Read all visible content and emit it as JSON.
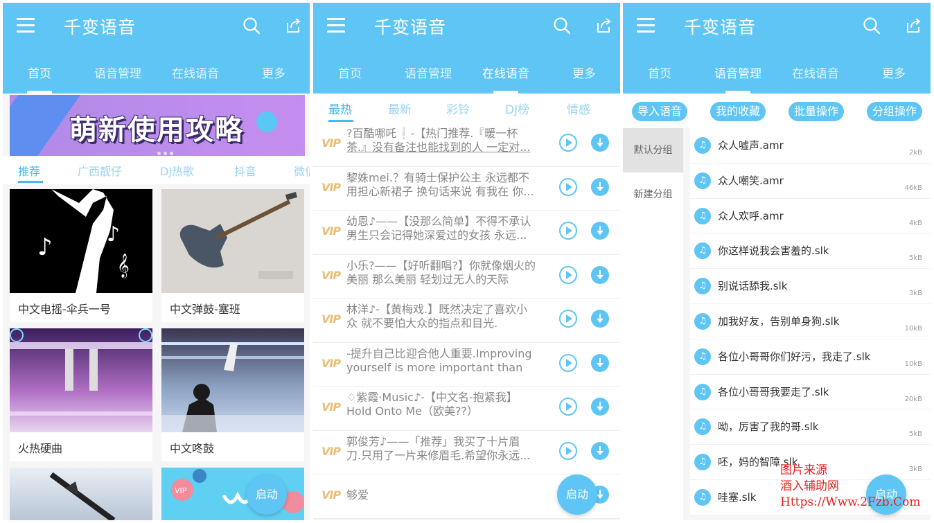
{
  "app_title": "千变语音",
  "tabs": [
    "首页",
    "语音管理",
    "在线语音",
    "更多"
  ],
  "screen1": {
    "banner_text": "萌新使用攻略",
    "categories": [
      "推荐",
      "广西靓仔",
      "DJ热歌",
      "抖音",
      "微信"
    ],
    "cards": [
      {
        "label": "中文电摇-伞兵一号"
      },
      {
        "label": "中文弹鼓-塞班"
      },
      {
        "label": "火热硬曲"
      },
      {
        "label": "中文咚鼓"
      },
      {
        "label": ""
      },
      {
        "label": ""
      }
    ],
    "card4_image_text": "VIP",
    "fab": "启动"
  },
  "screen2": {
    "subtabs": [
      "最热",
      "最新",
      "彩铃",
      "DJ榜",
      "情感"
    ],
    "vip_label": "VIP",
    "items": [
      {
        "line1": "?百酷哪吒❕-【热门推荐.『暖一杯",
        "line2": "茶.』没有备注也能找到的人 一定对..."
      },
      {
        "line1": "黎姝mei.？有骑士保护公主 永远都不",
        "line2": "用担心新裙子 换句话来说 有我在 你..."
      },
      {
        "line1": "幼恩♪——【没那么简单】不得不承认",
        "line2": "男生只会记得她深爱过的女孩 永远..."
      },
      {
        "line1": "小乐?——【好听翻唱?】你就像烟火的",
        "line2": "美丽 那么美丽 轻划过无人的天际"
      },
      {
        "line1": "林洋♪-【黄梅戏.】既然决定了喜欢小",
        "line2": "众 就不要怕大众的指点和目光."
      },
      {
        "line1": "-提升自己比迎合他人重要.Improving",
        "line2": "yourself is more important than cat..."
      },
      {
        "line1": "♢紫霞·Music♪-【中文名-抱紧我】",
        "line2": "Hold Onto Me（欧美??）"
      },
      {
        "line1": "郭俊芳♪——「推荐」我买了十片眉",
        "line2": "刀.只用了一片来修眉毛.希望你永远..."
      },
      {
        "line1": "够爱",
        "line2": ""
      }
    ],
    "fab": "启动"
  },
  "screen3": {
    "pills": [
      "导入语音",
      "我的收藏",
      "批量操作",
      "分组操作"
    ],
    "groups": [
      "默认分组",
      "新建分组"
    ],
    "files": [
      {
        "name": "众人嘘声.amr",
        "size": "2kB"
      },
      {
        "name": "众人嘲笑.amr",
        "size": "46kB"
      },
      {
        "name": "众人欢呼.amr",
        "size": "4kB"
      },
      {
        "name": "你这样说我会害羞的.slk",
        "size": "5kB"
      },
      {
        "name": "别说话舔我.slk",
        "size": "3kB"
      },
      {
        "name": "加我好友，告别单身狗.slk",
        "size": "10kB"
      },
      {
        "name": "各位小哥哥你们好污，我走了.slk",
        "size": "10kB"
      },
      {
        "name": "各位小哥哥我要走了.slk",
        "size": "20kB"
      },
      {
        "name": "呦，厉害了我的哥.slk",
        "size": "5kB"
      },
      {
        "name": "呸，妈的智障.slk",
        "size": "3kB"
      },
      {
        "name": "哇塞.slk",
        "size": ""
      }
    ],
    "note_icon": "♫",
    "fab": "启动"
  },
  "watermark": {
    "line1": "图片来源",
    "line2": "酒入辅助网",
    "line3": "Https://Www.2Fzb.Com"
  },
  "colors": {
    "primary": "#5ec5f5",
    "vip": "#e9bf74",
    "watermark": "#ee1c1c"
  }
}
